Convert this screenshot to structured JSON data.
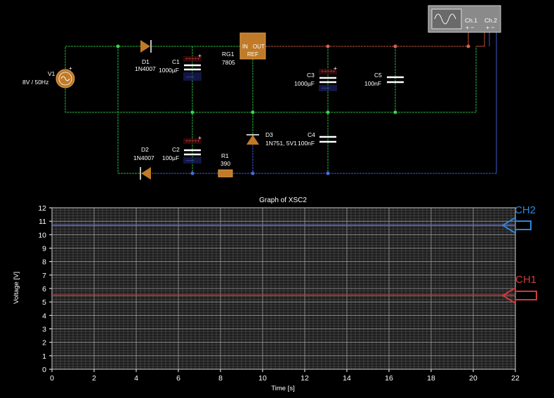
{
  "schematic": {
    "components": {
      "v1": {
        "ref": "V1",
        "value": "8V / 50Hz"
      },
      "d1": {
        "ref": "D1",
        "value": "1N4007"
      },
      "d2": {
        "ref": "D2",
        "value": "1N4007"
      },
      "c1": {
        "ref": "C1",
        "value": "1000µF"
      },
      "c2": {
        "ref": "C2",
        "value": "100µF"
      },
      "c3": {
        "ref": "C3",
        "value": "1000µF"
      },
      "c4": {
        "ref": "C4",
        "value": "100nF"
      },
      "c5": {
        "ref": "C5",
        "value": "100nF"
      },
      "rg1": {
        "ref": "RG1",
        "value": "7805",
        "pin_in": "IN",
        "pin_out": "OUT",
        "pin_ref": "REF"
      },
      "d3": {
        "ref": "D3",
        "value": "1N751, 5V1"
      },
      "r1": {
        "ref": "R1",
        "value": "390"
      }
    },
    "scope": {
      "ch1": "Ch.1",
      "ch2": "Ch.2",
      "pins": "+ −"
    },
    "colors": {
      "green_wire": "#28b43c",
      "red_wire": "#c0503a",
      "blue_wire": "#3c5ac8",
      "part": "#c07a28"
    }
  },
  "graph": {
    "title": "Graph of XSC2",
    "annotations": {
      "ch1": "CH1",
      "ch2": "CH2"
    },
    "ann_colors": {
      "ch1": "#d03a3a",
      "ch2": "#2f86d8"
    }
  },
  "chart_data": {
    "type": "line",
    "title": "Graph of XSC2",
    "xlabel": "Time [s]",
    "ylabel": "Voltage [V]",
    "xlim": [
      0,
      22
    ],
    "ylim": [
      0,
      12
    ],
    "xticks": [
      0,
      2,
      4,
      6,
      8,
      10,
      12,
      14,
      16,
      18,
      20,
      22
    ],
    "yticks": [
      0,
      1,
      2,
      3,
      4,
      5,
      6,
      7,
      8,
      9,
      10,
      11,
      12
    ],
    "grid": true,
    "series": [
      {
        "color": "#cc3a3a",
        "x": [
          0,
          22
        ],
        "y": [
          5.5,
          5.5
        ]
      },
      {
        "color": "#5a66e0",
        "x": [
          0,
          22
        ],
        "y": [
          10.7,
          10.7
        ]
      }
    ]
  }
}
